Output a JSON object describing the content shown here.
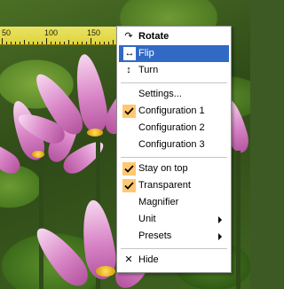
{
  "ruler": {
    "ticks": [
      "50",
      "100",
      "150"
    ]
  },
  "menu": {
    "items": [
      {
        "label": "Rotate",
        "icon": "rotate-icon",
        "bold": true
      },
      {
        "label": "Flip",
        "icon": "flip-horizontal-icon",
        "highlighted": true
      },
      {
        "label": "Turn",
        "icon": "turn-vertical-icon"
      },
      {
        "label": "Settings..."
      },
      {
        "label": "Configuration 1",
        "checked": true
      },
      {
        "label": "Configuration 2"
      },
      {
        "label": "Configuration 3"
      },
      {
        "label": "Stay on top",
        "checked": true
      },
      {
        "label": "Transparent",
        "checked": true
      },
      {
        "label": "Magnifier"
      },
      {
        "label": "Unit",
        "submenu": true
      },
      {
        "label": "Presets",
        "submenu": true
      },
      {
        "label": "Hide",
        "icon": "close-icon"
      }
    ]
  },
  "colors": {
    "highlight": "#316ac5",
    "check_background": "#ffc870",
    "ruler": "#e7da3e"
  }
}
